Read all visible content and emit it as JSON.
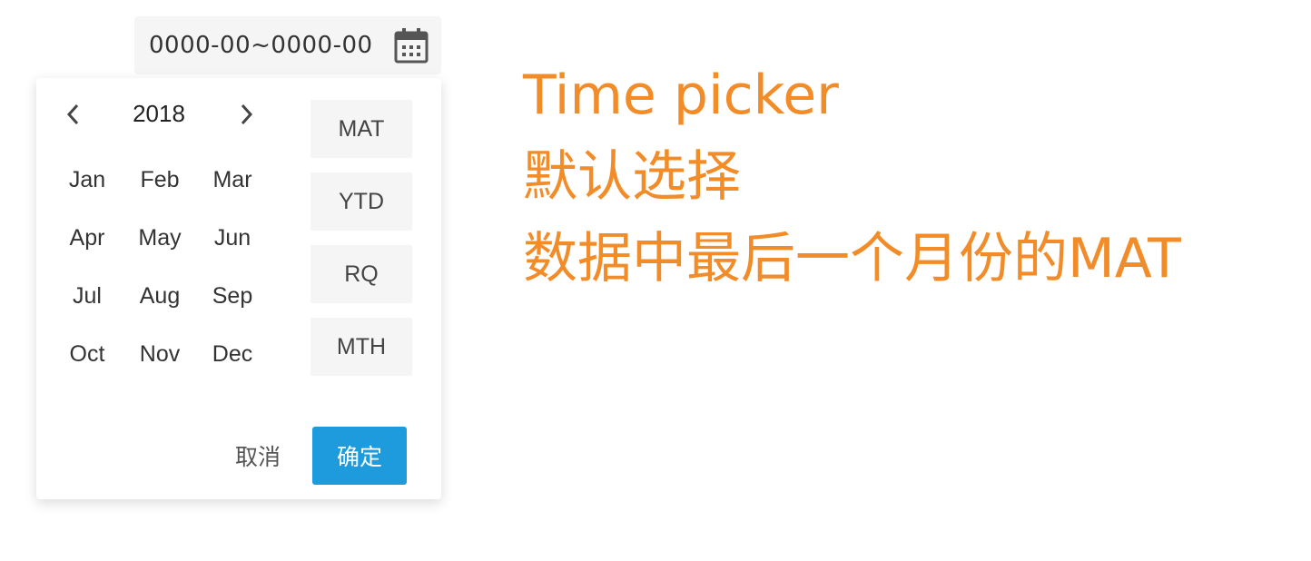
{
  "date_input": {
    "value": "0000-00~0000-00",
    "icon": "calendar-icon"
  },
  "picker": {
    "year": "2018",
    "prev_icon": "chevron-left-icon",
    "next_icon": "chevron-right-icon",
    "months": [
      "Jan",
      "Feb",
      "Mar",
      "Apr",
      "May",
      "Jun",
      "Jul",
      "Aug",
      "Sep",
      "Oct",
      "Nov",
      "Dec"
    ],
    "periods": [
      "MAT",
      "YTD",
      "RQ",
      "MTH"
    ],
    "cancel_label": "取消",
    "confirm_label": "确定"
  },
  "annotation": {
    "lines": [
      "Time picker",
      "默认选择",
      "数据中最后一个月份的MAT"
    ]
  },
  "colors": {
    "accent": "#1e9bdc",
    "annotation": "#f28c28",
    "input_bg": "#f5f5f5"
  }
}
